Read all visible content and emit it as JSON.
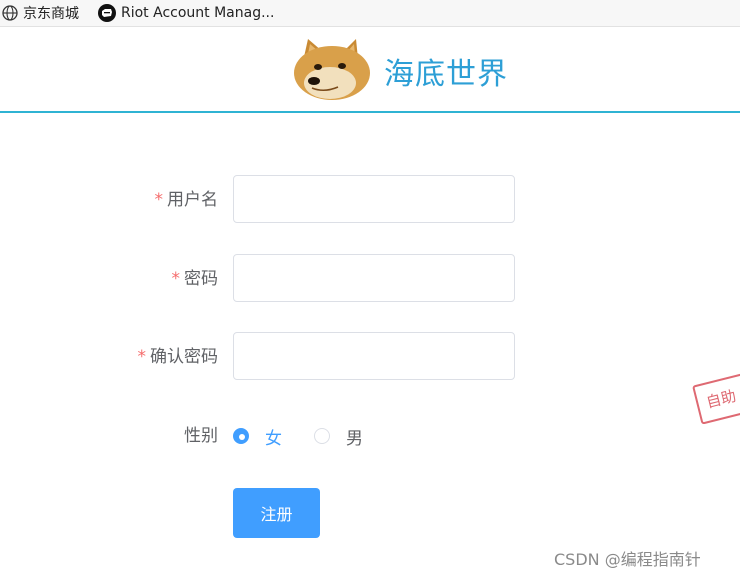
{
  "bookmarks": [
    {
      "label": "京东商城",
      "icon": "globe-icon"
    },
    {
      "label": "Riot Account Manag...",
      "icon": "riot-fist-icon"
    }
  ],
  "header": {
    "brand": "海底世界",
    "logo_icon": "doge-logo"
  },
  "form": {
    "username": {
      "label": "用户名",
      "required_mark": "*",
      "value": ""
    },
    "password": {
      "label": "密码",
      "required_mark": "*",
      "value": ""
    },
    "confirm": {
      "label": "确认密码",
      "required_mark": "*",
      "value": ""
    },
    "gender": {
      "label": "性别",
      "options": [
        {
          "label": "女",
          "checked": true
        },
        {
          "label": "男",
          "checked": false
        }
      ]
    },
    "submit_label": "注册"
  },
  "colors": {
    "primary": "#409eff",
    "required": "#f56c6c",
    "header_border": "#2fb3d3",
    "brand": "#2d9fd6"
  },
  "stamp_text": "自助",
  "watermark": "CSDN @编程指南针"
}
